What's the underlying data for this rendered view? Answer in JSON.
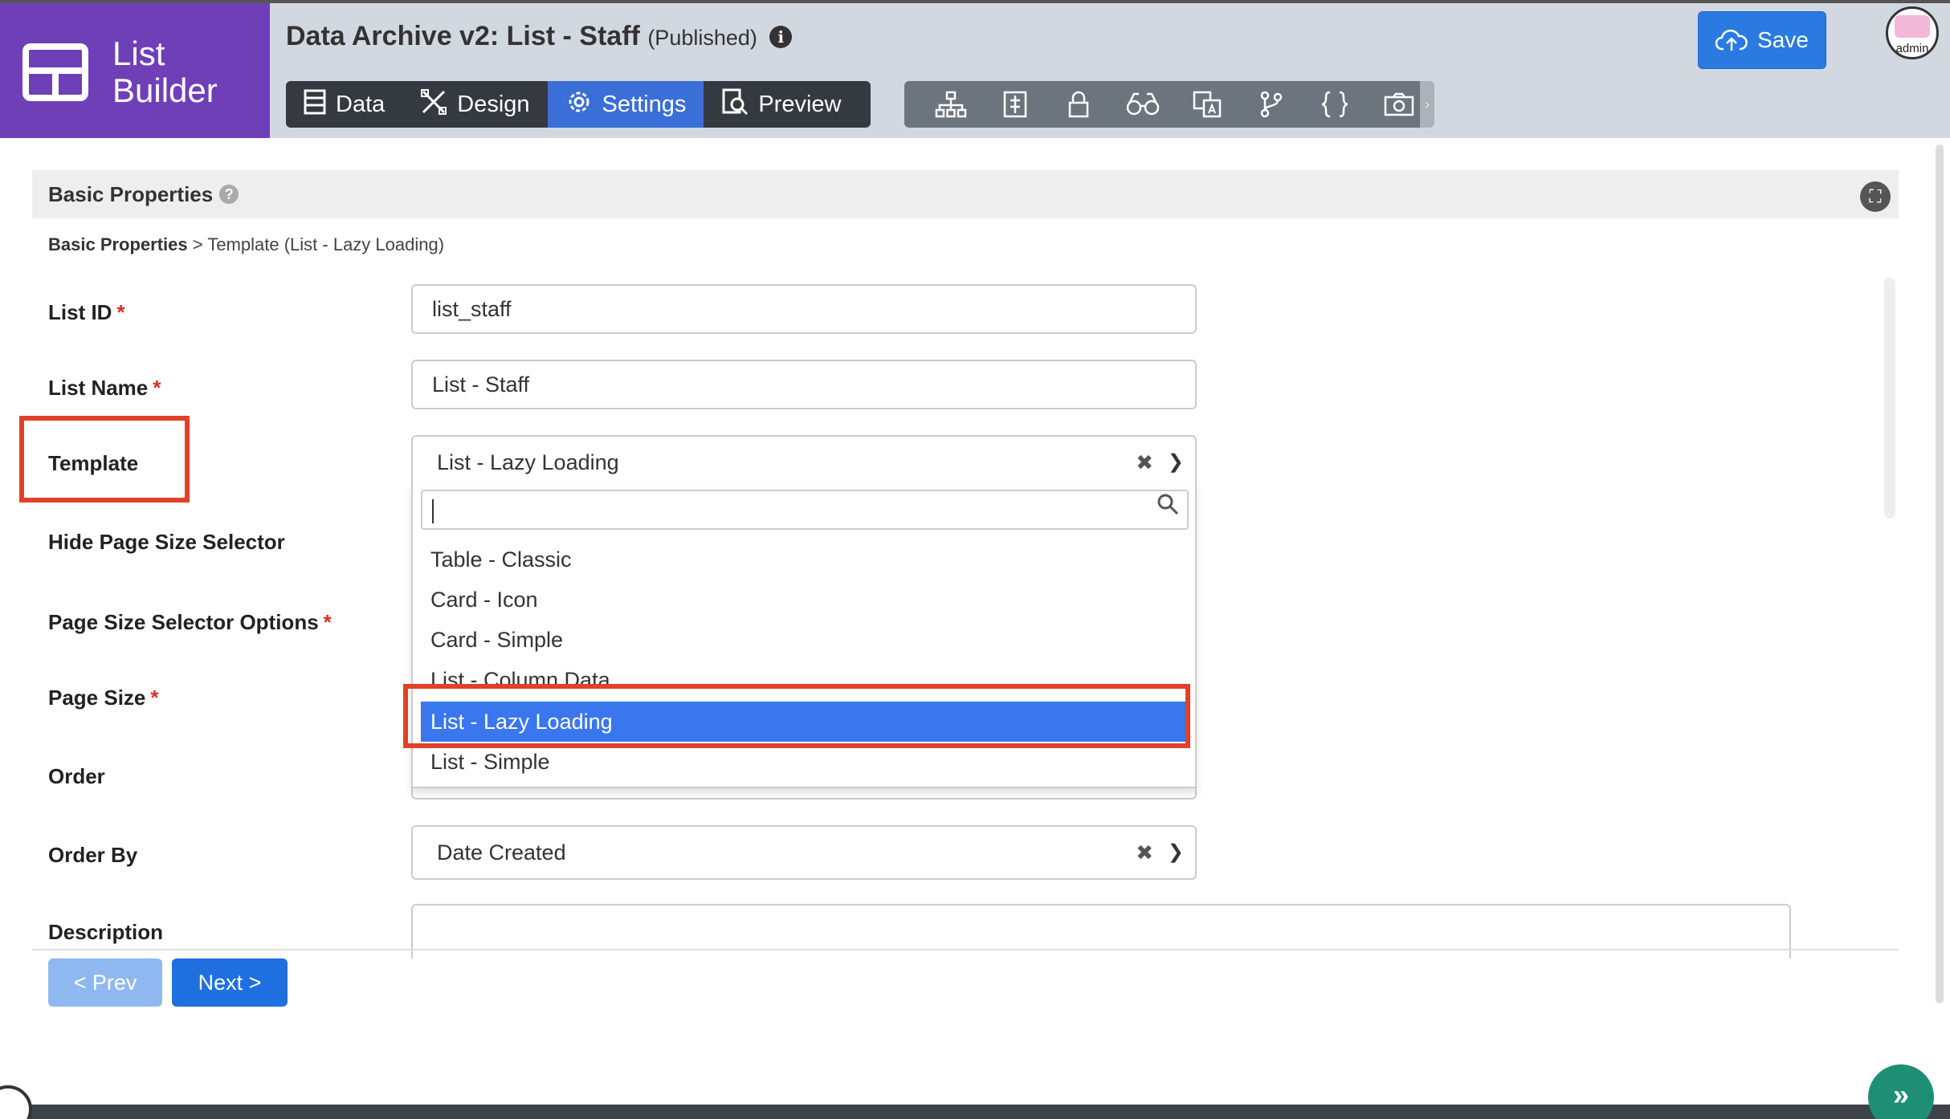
{
  "brand": {
    "line1": "List",
    "line2": "Builder"
  },
  "header": {
    "title": "Data Archive v2: List - Staff",
    "status": "(Published)",
    "info_glyph": "i",
    "tabs": [
      {
        "label": "Data",
        "icon": "table-icon"
      },
      {
        "label": "Design",
        "icon": "design-tools-icon"
      },
      {
        "label": "Settings",
        "icon": "gear-icon"
      },
      {
        "label": "Preview",
        "icon": "preview-doc-icon"
      }
    ],
    "active_tab": "Settings",
    "toolbar_icons": [
      "sitemap-icon",
      "column-icon",
      "lock-icon",
      "binoculars-icon",
      "translate-icon",
      "branch-icon",
      "json-braces-icon",
      "camera-icon"
    ],
    "save_label": "Save",
    "avatar_label": "admin"
  },
  "section": {
    "title": "Basic Properties"
  },
  "breadcrumb": {
    "root": "Basic Properties",
    "separator": ">",
    "current": "Template (List - Lazy Loading)"
  },
  "form": {
    "list_id": {
      "label": "List ID",
      "value": "list_staff"
    },
    "list_name": {
      "label": "List Name",
      "value": "List - Staff"
    },
    "template": {
      "label": "Template",
      "value": "List - Lazy Loading"
    },
    "hide_page_size_selector": {
      "label": "Hide Page Size Selector"
    },
    "page_size_selector_options": {
      "label": "Page Size Selector Options"
    },
    "page_size": {
      "label": "Page Size"
    },
    "order": {
      "label": "Order"
    },
    "order_by": {
      "label": "Order By",
      "value": "Date Created"
    },
    "description": {
      "label": "Description"
    },
    "required_marker": "*"
  },
  "dropdown": {
    "search_value": "",
    "options": [
      "Table - Classic",
      "Card - Icon",
      "Card - Simple",
      "List - Column Data",
      "List - Lazy Loading",
      "List - Simple"
    ],
    "selected": "List - Lazy Loading"
  },
  "nav": {
    "prev": "< Prev",
    "next": "Next >"
  },
  "colors": {
    "brand": "#6f3fb8",
    "accent": "#2a7ae2",
    "highlight": "#e2402a",
    "selected_option": "#3a77ee"
  }
}
